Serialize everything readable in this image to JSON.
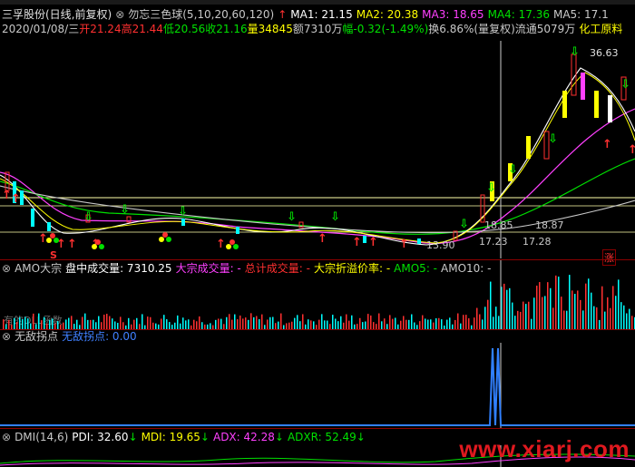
{
  "main": {
    "title": "三孚股份(日线,前复权)",
    "indicator_name": "勿忘三色球(5,10,20,60,120)",
    "ma1": "MA1: 21.15",
    "ma2": "MA2: 20.38",
    "ma3": "MA3: 18.65",
    "ma4": "MA4: 17.36",
    "ma5": "MA5: 17.1",
    "date": "2020/01/08/三",
    "open": "开21.24",
    "high": "高21.44",
    "low": "低20.56",
    "close": "收21.16",
    "volume": "量34845",
    "amount": "额7310万",
    "change": "幅-0.32(-1.49%)",
    "turnover": "换6.86%(量复权)",
    "float": "流通5079万",
    "sector": "化工原料",
    "price_high": "36.63",
    "label_a": "18.85",
    "label_b": "18.87",
    "label_c": "17.23",
    "label_d": "17.28",
    "price_low": "13.90",
    "zhang": "涨",
    "s_label": "S",
    "colors": {
      "red": "#ff3030",
      "green": "#00e000",
      "yellow": "#ffff00",
      "magenta": "#ff40ff",
      "cyan": "#00ffff",
      "white": "#ffffff"
    }
  },
  "amo": {
    "name": "AMO大宗",
    "mid_volume": "盘中成交量: 7310.25",
    "block_volume": "大宗成交量: -",
    "total_volume": "总计成交量: -",
    "premium": "大宗折溢价率: -",
    "amo5": "AMO5: -",
    "amo10": "AMO10: -",
    "dll_label": "有的DLL函数"
  },
  "wushu": {
    "name": "无敌拐点",
    "value": "无敌拐点: 0.00"
  },
  "dmi": {
    "name": "DMI(14,6)",
    "pdi": "PDI: 32.60",
    "mdi": "MDI: 19.65",
    "adx": "ADX: 42.28",
    "adxr": "ADXR: 52.49"
  },
  "watermark": "www.xiarj.com"
}
